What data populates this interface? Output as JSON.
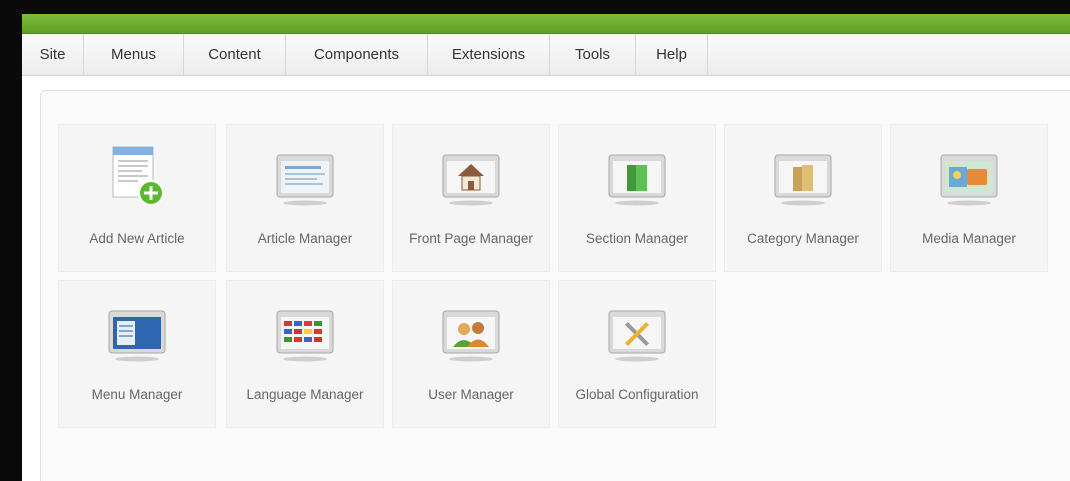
{
  "menubar": {
    "items": [
      {
        "label": "Site"
      },
      {
        "label": "Menus"
      },
      {
        "label": "Content"
      },
      {
        "label": "Components"
      },
      {
        "label": "Extensions"
      },
      {
        "label": "Tools"
      },
      {
        "label": "Help"
      }
    ]
  },
  "cpanel": {
    "tiles": [
      {
        "label": "Add New Article",
        "icon": "add-article-icon"
      },
      {
        "label": "Article Manager",
        "icon": "article-manager-icon"
      },
      {
        "label": "Front Page Manager",
        "icon": "front-page-icon"
      },
      {
        "label": "Section Manager",
        "icon": "section-icon"
      },
      {
        "label": "Category Manager",
        "icon": "category-icon"
      },
      {
        "label": "Media Manager",
        "icon": "media-icon"
      },
      {
        "label": "Menu Manager",
        "icon": "menu-manager-icon"
      },
      {
        "label": "Language Manager",
        "icon": "language-icon"
      },
      {
        "label": "User Manager",
        "icon": "user-manager-icon"
      },
      {
        "label": "Global Configuration",
        "icon": "global-config-icon"
      }
    ]
  },
  "colors": {
    "accent_green": "#6aab2c",
    "frame_black": "#0a0a0a"
  }
}
